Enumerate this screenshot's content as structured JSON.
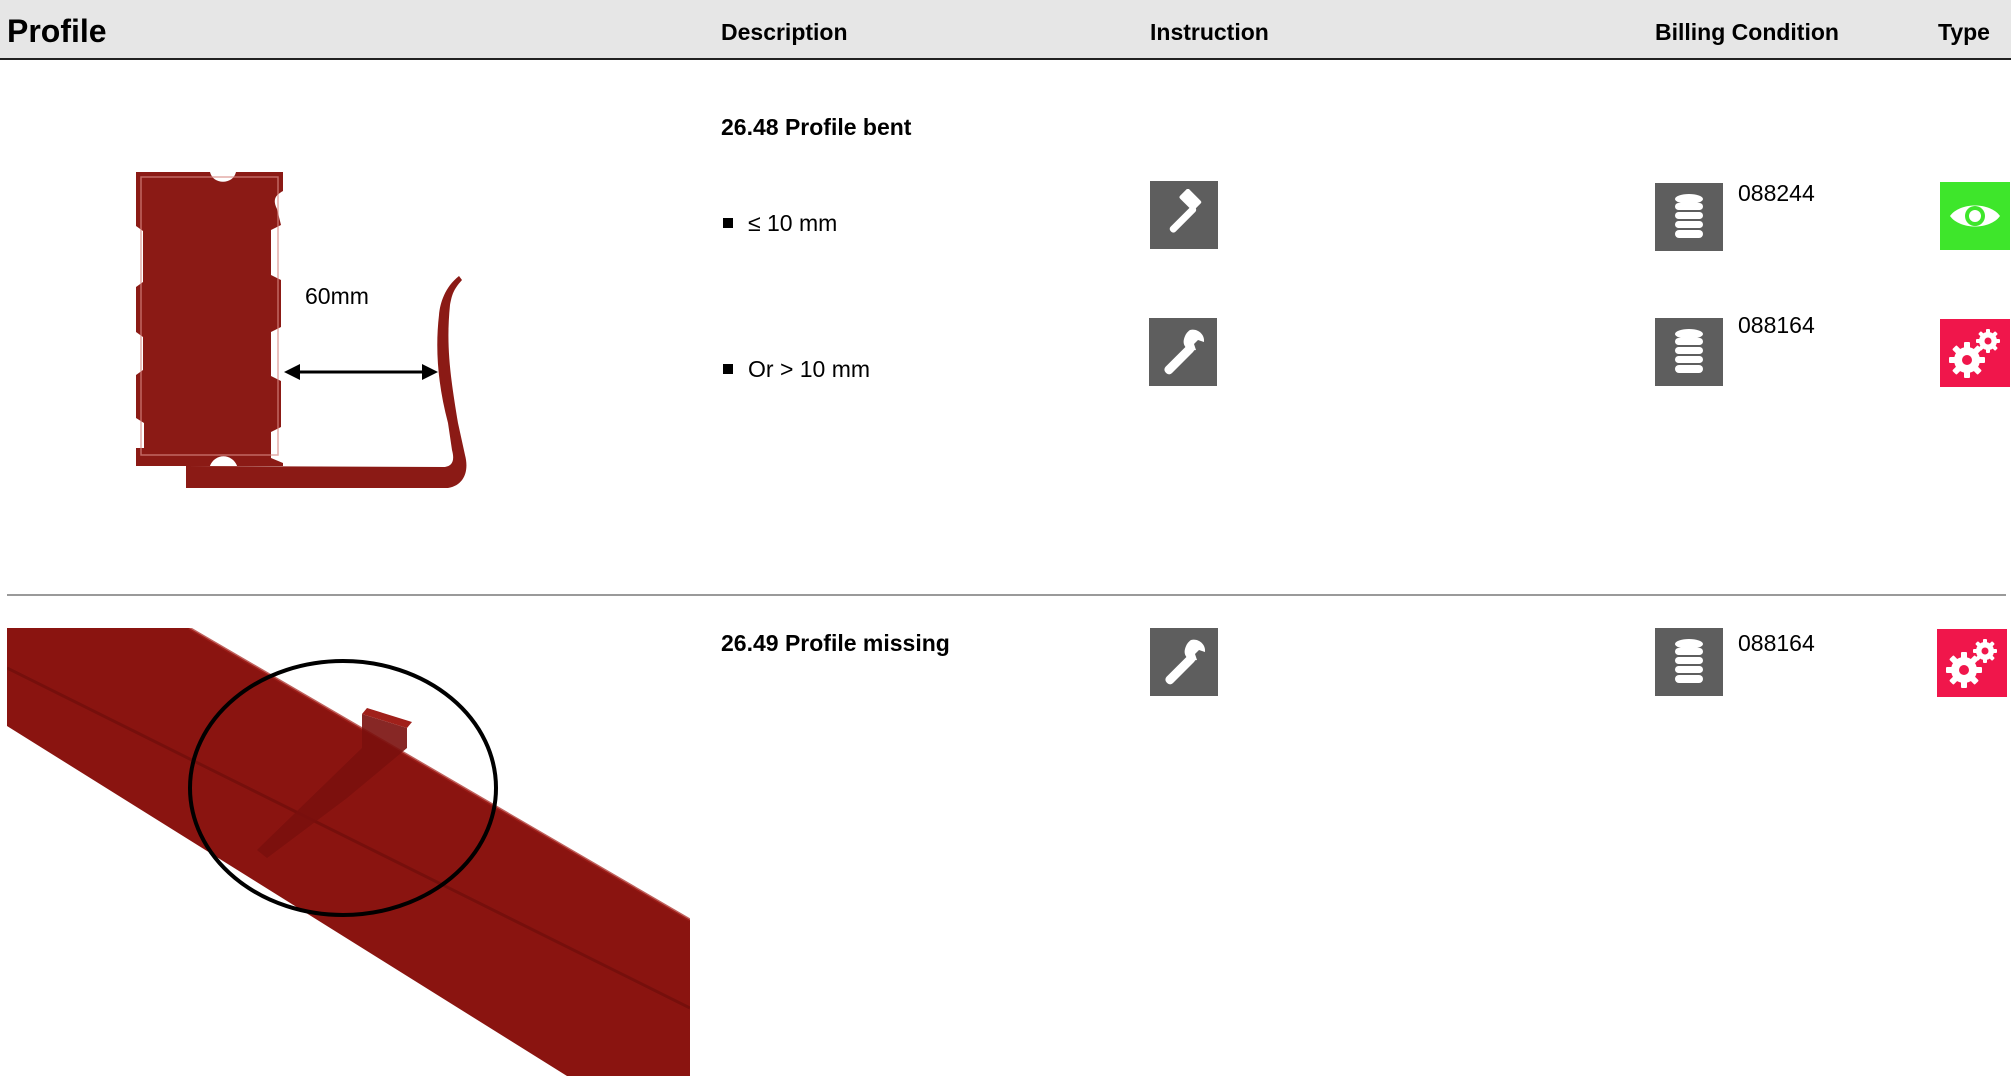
{
  "header": {
    "title": "Profile",
    "description": "Description",
    "instruction": "Instruction",
    "billing_condition": "Billing Condition",
    "type": "Type"
  },
  "sections": [
    {
      "title": "26.48 Profile bent",
      "image_label": "60mm",
      "rows": [
        {
          "condition": "≤ 10 mm",
          "instruction_icon": "hammer-icon",
          "billing_icon": "coin-stack-icon",
          "billing_code": "088244",
          "type_icon": "eye-icon",
          "type_color": "#3ee62b"
        },
        {
          "condition": "Or > 10 mm",
          "instruction_icon": "wrench-icon",
          "billing_icon": "coin-stack-icon",
          "billing_code": "088164",
          "type_icon": "gears-icon",
          "type_color": "#f0164b"
        }
      ]
    },
    {
      "title": "26.49 Profile missing",
      "rows": [
        {
          "instruction_icon": "wrench-icon",
          "billing_icon": "coin-stack-icon",
          "billing_code": "088164",
          "type_icon": "gears-icon",
          "type_color": "#f0164b"
        }
      ]
    }
  ],
  "colors": {
    "header_bg": "#e6e6e6",
    "icon_bg": "#5e5e5e",
    "profile_red": "#8b1a15"
  }
}
